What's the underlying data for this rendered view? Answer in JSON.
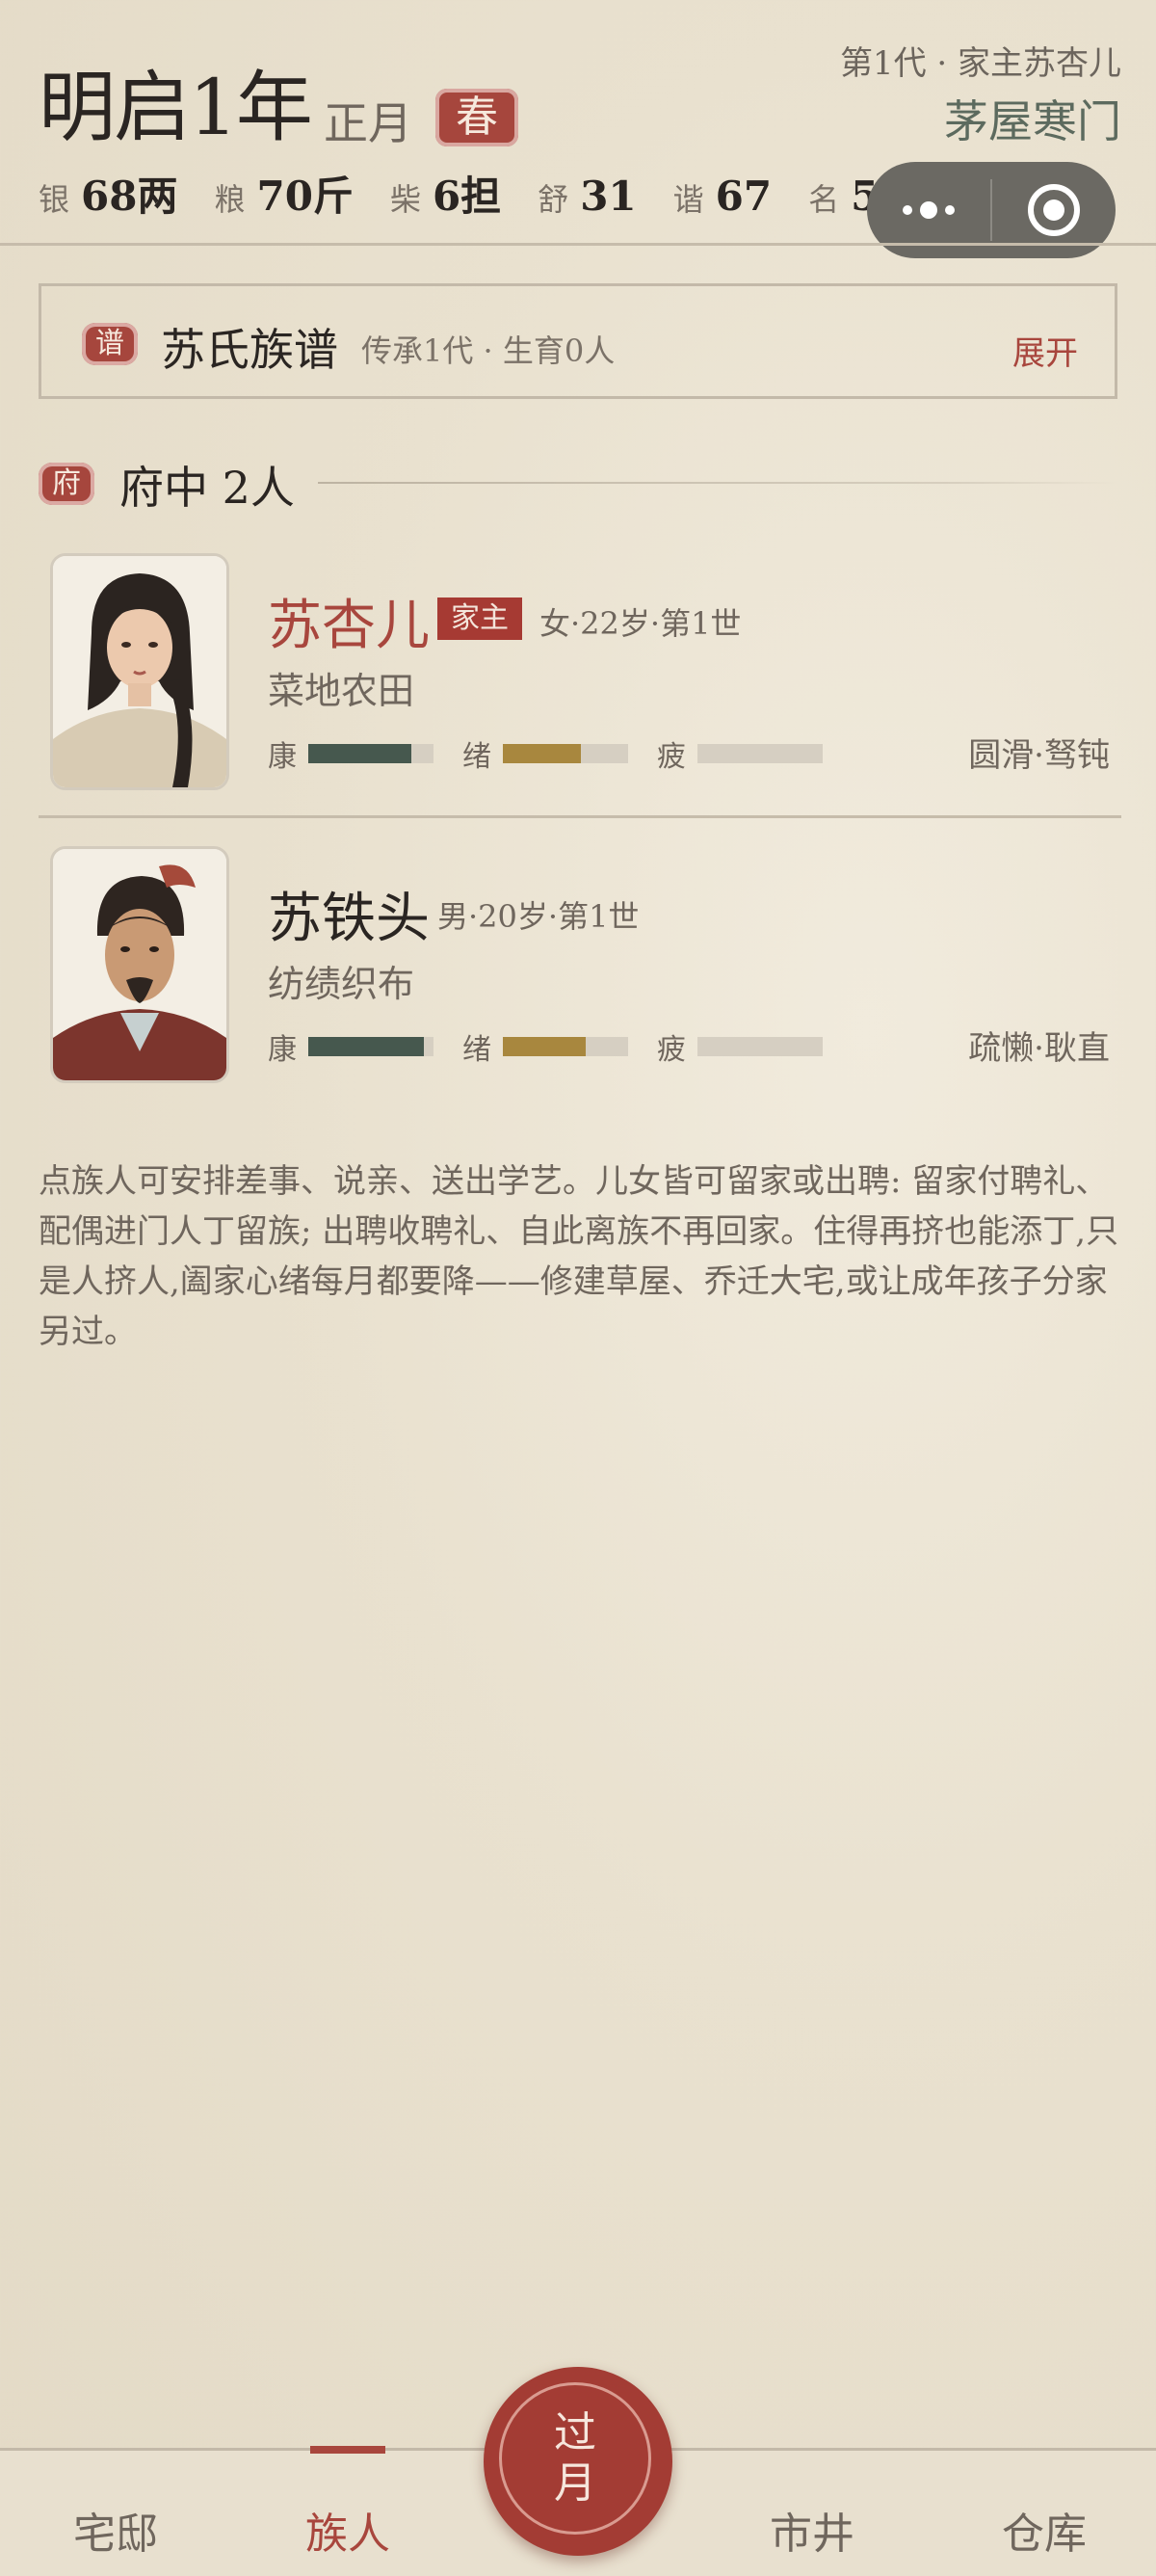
{
  "header": {
    "year": "明启1年",
    "month": "正月",
    "season": "春",
    "generation": "第1代 · 家主苏杏儿",
    "house": "茅屋寒门",
    "stats": [
      {
        "key": "银",
        "value": "68两"
      },
      {
        "key": "粮",
        "value": "70斤"
      },
      {
        "key": "柴",
        "value": "6担"
      },
      {
        "key": "舒",
        "value": "31"
      },
      {
        "key": "谐",
        "value": "67"
      },
      {
        "key": "名",
        "value": "5"
      }
    ]
  },
  "capsule": {
    "more_icon": "more-dots-icon",
    "close_icon": "target-circle-icon",
    "color": "#6b6963"
  },
  "genealogy": {
    "badge": "谱",
    "title": "苏氏族谱",
    "subtitle": "传承1代 · 生育0人",
    "expand": "展开"
  },
  "section": {
    "badge": "府",
    "title": "府中 2人"
  },
  "members": [
    {
      "name": "苏杏儿",
      "tag": "家主",
      "info": "女·22岁·第1世",
      "job": "菜地农田",
      "bars": [
        {
          "label": "康",
          "level": 0.82,
          "color": "#46584e"
        },
        {
          "label": "绪",
          "level": 0.62,
          "color": "#a8873e"
        },
        {
          "label": "疲",
          "level": 0.0,
          "color": "#c9c1b4"
        }
      ],
      "traits": "圆滑·驽钝"
    },
    {
      "name": "苏铁头",
      "tag": "",
      "info": "男·20岁·第1世",
      "job": "纺绩织布",
      "bars": [
        {
          "label": "康",
          "level": 0.92,
          "color": "#46584e"
        },
        {
          "label": "绪",
          "level": 0.66,
          "color": "#a8873e"
        },
        {
          "label": "疲",
          "level": 0.0,
          "color": "#c9c1b4"
        }
      ],
      "traits": "疏懒·耿直"
    }
  ],
  "description": "点族人可安排差事、说亲、送出学艺。儿女皆可留家或出聘: 留家付聘礼、配偶进门人丁留族; 出聘收聘礼、自此离族不再回家。住得再挤也能添丁,只是人挤人,阖家心绪每月都要降——修建草屋、乔迁大宅,或让成年孩子分家另过。",
  "nav": {
    "tabs": [
      "宅邸",
      "族人",
      "市井",
      "仓库"
    ],
    "active": "族人",
    "center_line1": "过",
    "center_line2": "月"
  },
  "colors": {
    "accent": "#a8463d",
    "background": "#ece5d5"
  }
}
